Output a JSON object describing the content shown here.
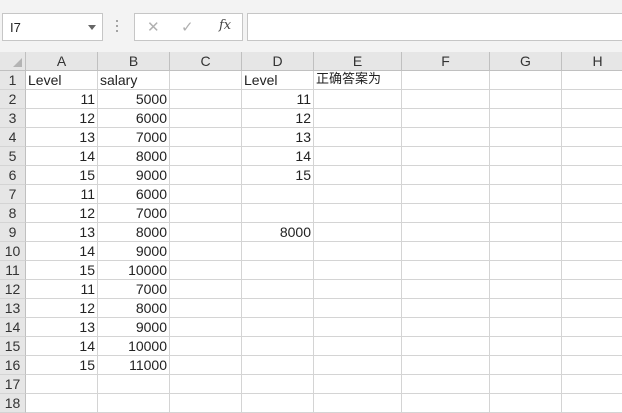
{
  "formula_bar": {
    "name_box": "I7",
    "cancel_symbol": "✕",
    "enter_symbol": "✓",
    "fx_label": "fx",
    "formula": ""
  },
  "columns": [
    "A",
    "B",
    "C",
    "D",
    "E",
    "F",
    "G",
    "H"
  ],
  "rows": [
    "1",
    "2",
    "3",
    "4",
    "5",
    "6",
    "7",
    "8",
    "9",
    "10",
    "11",
    "12",
    "13",
    "14",
    "15",
    "16",
    "17",
    "18"
  ],
  "cells": {
    "A1": "Level",
    "B1": "salary",
    "D1": "Level",
    "E1": "正确答案为",
    "A2": "11",
    "B2": "5000",
    "D2": "11",
    "A3": "12",
    "B3": "6000",
    "D3": "12",
    "A4": "13",
    "B4": "7000",
    "D4": "13",
    "A5": "14",
    "B5": "8000",
    "D5": "14",
    "A6": "15",
    "B6": "9000",
    "D6": "15",
    "A7": "11",
    "B7": "6000",
    "A8": "12",
    "B8": "7000",
    "A9": "13",
    "B9": "8000",
    "D9": "8000",
    "A10": "14",
    "B10": "9000",
    "A11": "15",
    "B11": "10000",
    "A12": "11",
    "B12": "7000",
    "A13": "12",
    "B13": "8000",
    "A14": "13",
    "B14": "9000",
    "A15": "14",
    "B15": "10000",
    "A16": "15",
    "B16": "11000"
  }
}
